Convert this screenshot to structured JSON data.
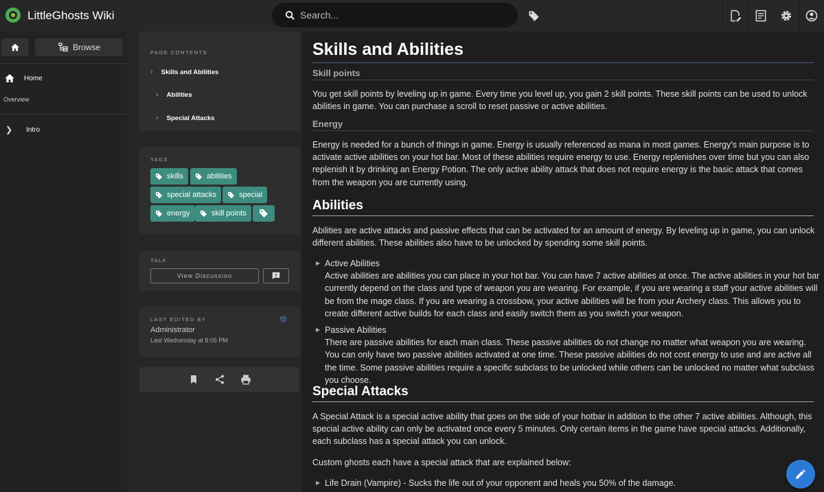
{
  "app": {
    "title": "LittleGhosts Wiki"
  },
  "search": {
    "placeholder": "Search..."
  },
  "sidebar": {
    "browse_label": "Browse",
    "home_label": "Home",
    "overview_label": "Overview",
    "intro_label": "Intro"
  },
  "toc": {
    "label": "PAGE CONTENTS",
    "items": [
      "Skills and Abilities",
      "Abilities",
      "Special Attacks"
    ]
  },
  "tags": {
    "label": "TAGS",
    "items": [
      "skills",
      "abilities",
      "special attacks",
      "special",
      "energy",
      "skill points",
      ""
    ]
  },
  "talk": {
    "label": "TALK",
    "view_discussion": "View Discussion"
  },
  "last_edited": {
    "label": "LAST EDITED BY",
    "name": "Administrator",
    "time": "Last Wednesday at 8:05 PM"
  },
  "content": {
    "title": "Skills and Abilities",
    "skill_points_heading": "Skill points",
    "skill_points_text": "You get skill points by leveling up in game. Every time you level up, you gain 2 skill points. These skill points can be used to unlock abilities in game. You can purchase a scroll to reset passive or active abilities.",
    "energy_heading": "Energy",
    "energy_text": "Energy is needed for a bunch of things in game. Energy is usually referenced as mana in most games. Energy's main purpose is to activate active abilities on your hot bar. Most of these abilities require energy to use. Energy replenishes over time but you can also replenish it by drinking an Energy Potion. The only active ability attack that does not require energy is the basic attack that comes from the weapon you are currently using.",
    "abilities_heading": "Abilities",
    "abilities_text": "Abilities are active attacks and passive effects that can be activated for an amount of energy. By leveling up in game, you can unlock different abilities. These abilities also have to be unlocked by spending some skill points.",
    "active_title": "Active Abilities",
    "active_text": "Active abilities are abilities you can place in your hot bar. You can have 7 active abilities at once. The active abilities in your hot bar currently depend on the class and type of weapon you are wearing. For example, if you are wearing a staff your active abilities will be from the mage class. If you are wearing a crossbow, your active abilities will be from your Archery class. This allows you to create different active builds for each class and easily switch them as you switch your weapon.",
    "passive_title": "Passive Abilities",
    "passive_text": "There are passive abilities for each main class. These passive abilities do not change no matter what weapon you are wearing. You can only have two passive abilities activated at one time. These passive abilities do not cost energy to use and are active all the time. Some passive abilities require a specific subclass to be unlocked while others can be unlocked no matter what subclass you choose.",
    "special_heading": "Special Attacks",
    "special_text": "A Special Attack is a special active ability that goes on the side of your hotbar in addition to the other 7 active abilities. Although, this special active ability can only be activated once every 5 minutes. Only certain items in the game have special attacks. Additionally, each subclass has a special attack you can unlock.",
    "custom_text": "Custom ghosts each have a special attack that are explained below:",
    "life_drain": "Life Drain (Vampire) - Sucks the life out of your opponent and heals you 50% of the damage."
  },
  "colors": {
    "tag_bg": "#3d8c7f",
    "fab": "#2b7bd6",
    "title_underline": "#4a5d86"
  },
  "icons": [
    "logo-icon",
    "search-icon",
    "tag-icon",
    "edit-page-icon",
    "notes-icon",
    "gear-icon",
    "account-icon",
    "home-icon",
    "browse-icon",
    "chevron-right-icon",
    "chat-icon",
    "history-icon",
    "bookmark-icon",
    "share-icon",
    "print-icon",
    "pencil-icon"
  ]
}
